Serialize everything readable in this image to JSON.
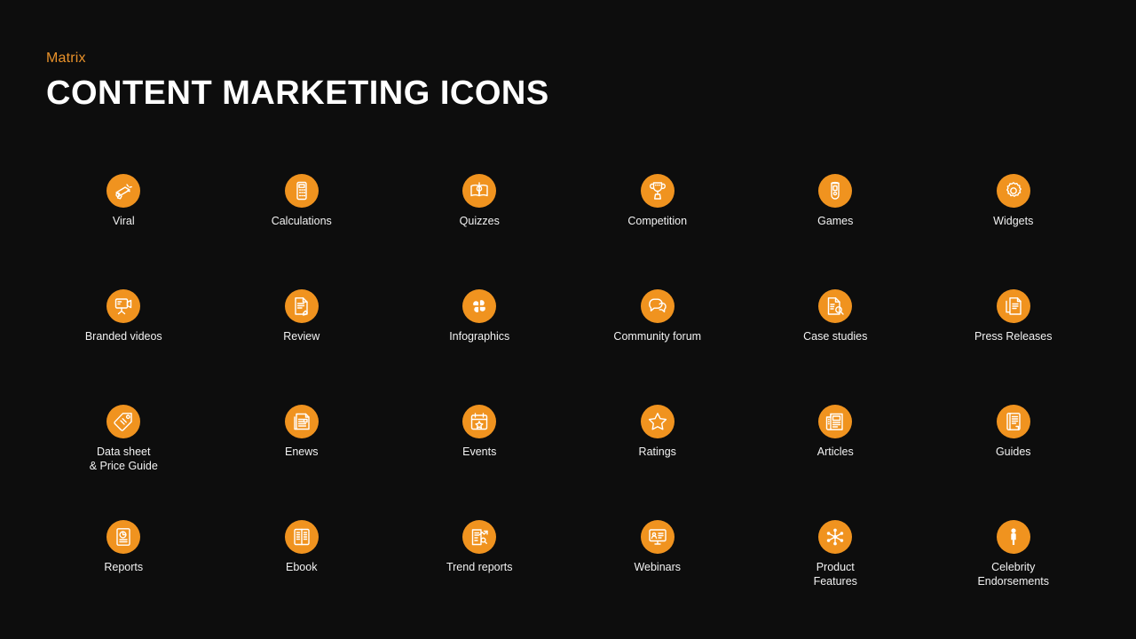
{
  "header": {
    "eyebrow": "Matrix",
    "title": "CONTENT MARKETING ICONS"
  },
  "theme": {
    "background": "#0d0d0d",
    "accent": "#f0931f",
    "eyebrow_color": "#e8912a",
    "label_color": "#f2f2f2",
    "title_color": "#ffffff"
  },
  "grid": {
    "columns": 6,
    "rows": 4,
    "items": [
      {
        "label": "Viral",
        "icon": "megaphone-icon"
      },
      {
        "label": "Calculations",
        "icon": "calculator-icon"
      },
      {
        "label": "Quizzes",
        "icon": "quiz-book-icon"
      },
      {
        "label": "Competition",
        "icon": "trophy-icon"
      },
      {
        "label": "Games",
        "icon": "gamepad-icon"
      },
      {
        "label": "Widgets",
        "icon": "gear-icon"
      },
      {
        "label": "Branded videos",
        "icon": "video-monitor-icon"
      },
      {
        "label": "Review",
        "icon": "review-document-icon"
      },
      {
        "label": "Infographics",
        "icon": "four-petal-icon"
      },
      {
        "label": "Community forum",
        "icon": "speech-bubbles-icon"
      },
      {
        "label": "Case studies",
        "icon": "document-magnifier-icon"
      },
      {
        "label": "Press Releases",
        "icon": "press-pages-icon"
      },
      {
        "label": "Data sheet\n& Price Guide",
        "icon": "price-tag-icon"
      },
      {
        "label": "Enews",
        "icon": "newsletter-icon"
      },
      {
        "label": "Events",
        "icon": "calendar-star-icon"
      },
      {
        "label": "Ratings",
        "icon": "star-icon"
      },
      {
        "label": "Articles",
        "icon": "newspaper-icon"
      },
      {
        "label": "Guides",
        "icon": "guide-book-icon"
      },
      {
        "label": "Reports",
        "icon": "report-chart-icon"
      },
      {
        "label": "Ebook",
        "icon": "ebook-icon"
      },
      {
        "label": "Trend reports",
        "icon": "trend-report-icon"
      },
      {
        "label": "Webinars",
        "icon": "webinar-screen-icon"
      },
      {
        "label": "Product\nFeatures",
        "icon": "network-nodes-icon"
      },
      {
        "label": "Celebrity\nEndorsements",
        "icon": "person-icon"
      }
    ]
  }
}
